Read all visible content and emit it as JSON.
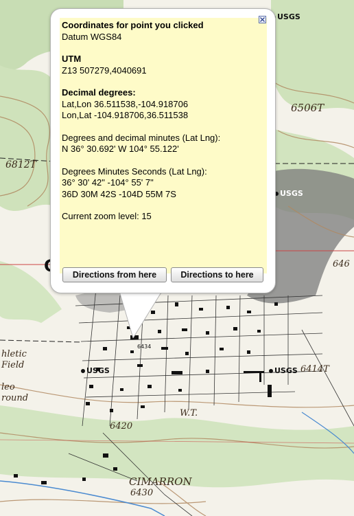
{
  "popup": {
    "title": "Coordinates for point you clicked",
    "datum": "Datum WGS84",
    "utm_heading": "UTM",
    "utm_value": "Z13  507279,4040691",
    "decimal_heading": "Decimal degrees:",
    "latlon": "Lat,Lon 36.511538,-104.918706",
    "lonlat": "Lon,Lat -104.918706,36.511538",
    "ddm_heading": "Degrees and decimal minutes (Lat Lng):",
    "ddm_value": "N 36° 30.692'  W 104° 55.122'",
    "dms_heading": "Degrees Minutes Seconds (Lat Lng):",
    "dms_value1": "36° 30' 42\"  -104° 55' 7\"",
    "dms_value2": "36D 30M 42S  -104D 55M 7S",
    "zoom": "Current zoom level: 15",
    "btn_from": "Directions from here",
    "btn_to": "Directions to here"
  },
  "map_labels": {
    "usgs": "USGS",
    "elev1": "6506T",
    "elev2": "6812T",
    "elev3": "646",
    "elev4": "6414T",
    "elev5": "6420",
    "elev6": "6430",
    "wt": "W.T.",
    "town": "CIMARRON",
    "athletic1": "hletic",
    "athletic2": "Field",
    "rodeo1": "leo",
    "rodeo2": "round",
    "bm": "6434",
    "c_letter": "C"
  }
}
